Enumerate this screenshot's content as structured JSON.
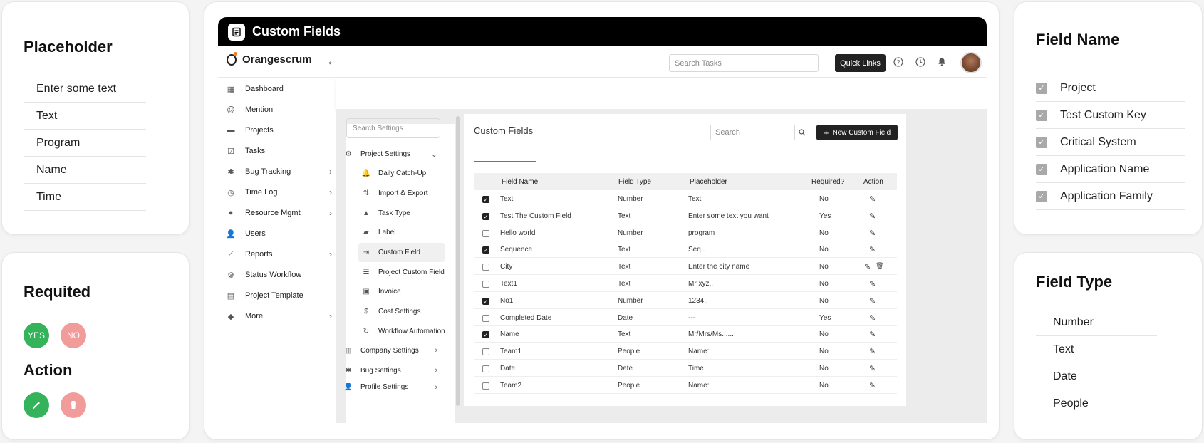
{
  "placeholder_card": {
    "title": "Placeholder",
    "items": [
      "Enter some text",
      "Text",
      "Program",
      "Name",
      "Time"
    ]
  },
  "required_card": {
    "title": "Requited",
    "yes": "YES",
    "no": "NO",
    "action_title": "Action"
  },
  "field_name_card": {
    "title": "Field Name",
    "items": [
      "Project",
      "Test Custom Key",
      "Critical System",
      "Application Name",
      "Application Family"
    ]
  },
  "field_type_card": {
    "title": "Field Type",
    "items": [
      "Number",
      "Text",
      "Date",
      "People"
    ]
  },
  "app": {
    "title": "Custom Fields",
    "logo": "Orangescrum",
    "search_tasks": "Search Tasks",
    "quick_links": "Quick Links",
    "sidebar": [
      "Dashboard",
      "Mention",
      "Projects",
      "Tasks",
      "Bug Tracking",
      "Time Log",
      "Resource Mgmt",
      "Users",
      "Reports",
      "Status Workflow",
      "Project Template",
      "More"
    ],
    "settings_search": "Search Settings",
    "settings": {
      "project_settings": "Project Settings",
      "sub": [
        "Daily Catch-Up",
        "Import & Export",
        "Task Type",
        "Label",
        "Custom Field",
        "Project Custom Field",
        "Invoice",
        "Cost Settings",
        "Workflow Automation"
      ],
      "company": "Company Settings",
      "bug": "Bug Settings",
      "profile": "Profile Settings"
    },
    "panel": {
      "title": "Custom Fields",
      "search": "Search",
      "new_button": "New Custom Field"
    },
    "table": {
      "headers": [
        "Field Name",
        "Field Type",
        "Placeholder",
        "Required?",
        "Action"
      ],
      "rows": [
        [
          "Text",
          "Number",
          "Text",
          "No"
        ],
        [
          "Test The Custom Field",
          "Text",
          "Enter some text you want",
          "Yes"
        ],
        [
          "Hello world",
          "Number",
          "program",
          "No"
        ],
        [
          "Sequence",
          "Text",
          "Seq..",
          "No"
        ],
        [
          "City",
          "Text",
          "Enter the city name",
          "No"
        ],
        [
          "Text1",
          "Text",
          "Mr xyz..",
          "No"
        ],
        [
          "No1",
          "Number",
          "1234..",
          "No"
        ],
        [
          "Completed Date",
          "Date",
          "---",
          "Yes"
        ],
        [
          "Name",
          "Text",
          "Mr/Mrs/Ms......",
          "No"
        ],
        [
          "Team1",
          "People",
          "Name:",
          "No"
        ],
        [
          "Date",
          "Date",
          "Time",
          "No"
        ],
        [
          "Team2",
          "People",
          "Name:",
          "No"
        ]
      ],
      "checked": [
        true,
        true,
        false,
        true,
        false,
        false,
        true,
        false,
        true,
        false,
        false,
        false
      ]
    }
  }
}
